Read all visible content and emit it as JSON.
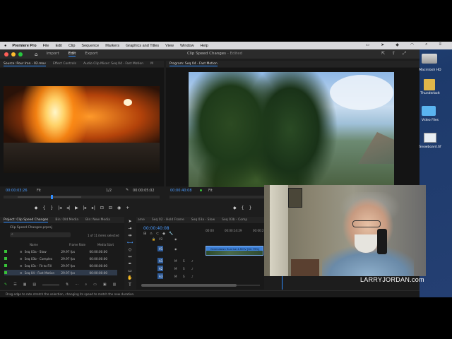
{
  "menubar": {
    "app": "Premiere Pro",
    "items": [
      "File",
      "Edit",
      "Clip",
      "Sequence",
      "Markers",
      "Graphics and Titles",
      "View",
      "Window",
      "Help"
    ]
  },
  "titlebar": {
    "tabs": [
      "Import",
      "Edit",
      "Export"
    ],
    "active_tab": "Edit",
    "project_title": "Clip Speed Changes",
    "edited_status": "- Edited"
  },
  "source_panel": {
    "tabs": [
      "Source: Pour Iron - 02.mov",
      "Effect Controls",
      "Audio Clip Mixer: Seq 04 - Fast Motion",
      "M"
    ],
    "timecode": "00:00:03:26",
    "fit": "Fit",
    "scale": "1/2",
    "duration": "00:00:05:02"
  },
  "program_panel": {
    "tab": "Program: Seq 04 - Fast Motion",
    "timecode": "00:00:40:08",
    "fit": "Fit"
  },
  "project_panel": {
    "tabs": [
      "Project: Clip Speed Changes",
      "Bin: Old Media",
      "Bin: New Media"
    ],
    "project_file": "Clip Speed Changes.prproj",
    "item_count": "1 of 11 items selected",
    "columns": [
      "Name",
      "Frame Rate",
      "Media Start"
    ],
    "rows": [
      {
        "name": "Seq 03a - Slow",
        "rate": "29.97 fps",
        "start": "00:00:00:00"
      },
      {
        "name": "Seq 03b - Complex",
        "rate": "29.97 fps",
        "start": "00:00:00:00"
      },
      {
        "name": "Seq 03c - Fit to Fill",
        "rate": "29.97 fps",
        "start": "00:00:00:00"
      },
      {
        "name": "Seq 04 - Fast Motion",
        "rate": "29.97 fps",
        "start": "00:00:00:00"
      }
    ]
  },
  "timeline": {
    "tabs": [
      "ame",
      "Seq 02 - Hold Frame",
      "Seq 03a - Slow",
      "Seq 03b - Comp"
    ],
    "timecode": "00:00:40:08",
    "ruler": [
      ":00:00",
      "00:00:14:29",
      "00:00:2"
    ],
    "tracks": [
      "V2",
      "V1",
      "A1",
      "A2",
      "A3"
    ],
    "clip_label": "Greendown Sunrise 4.MOV [62.79%]"
  },
  "status_bar": {
    "message": "Drag edge to rate stretch the selection, changing its speed to match the new duration."
  },
  "desktop": {
    "icons": [
      "Macintosh HD",
      "Thunderbolt",
      "Video Files",
      "Snowboard.tif"
    ]
  },
  "watermark": "LARRYJORDAN.com",
  "colors": {
    "accent": "#2f8cff",
    "timecode": "#4a9bff",
    "label_green": "#38c338",
    "clip_blue": "#3d7fd6"
  }
}
